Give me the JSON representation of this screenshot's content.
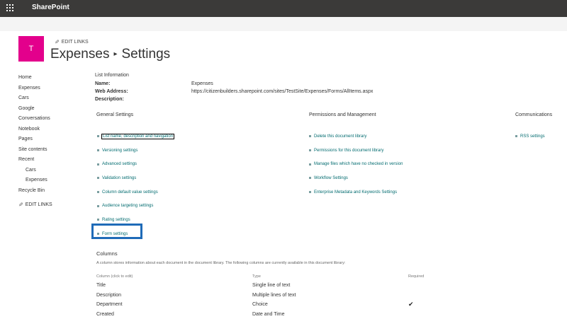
{
  "suitebar": {
    "brand": "SharePoint"
  },
  "site": {
    "logo_letter": "T",
    "edit_links": "EDIT LINKS"
  },
  "title": {
    "list": "Expenses",
    "separator": "▸",
    "page": "Settings"
  },
  "leftnav": {
    "items": [
      "Home",
      "Expenses",
      "Cars",
      "Google",
      "Conversations",
      "Notebook",
      "Pages",
      "Site contents",
      "Recent"
    ],
    "recent_items": [
      "Cars",
      "Expenses"
    ],
    "recycle": "Recycle Bin",
    "edit_links": "EDIT LINKS"
  },
  "list_info": {
    "heading": "List Information",
    "name_label": "Name:",
    "name_value": "Expenses",
    "address_label": "Web Address:",
    "address_value": "https://citizenbuilders.sharepoint.com/sites/TestSite/Expenses/Forms/AllItems.aspx",
    "description_label": "Description:"
  },
  "general": {
    "heading": "General Settings",
    "links": [
      "List name, description and navigation",
      "Versioning settings",
      "Advanced settings",
      "Validation settings",
      "Column default value settings",
      "Audience targeting settings",
      "Rating settings",
      "Form settings"
    ]
  },
  "permissions": {
    "heading": "Permissions and Management",
    "links": [
      "Delete this document library",
      "Permissions for this document library",
      "Manage files which have no checked in version",
      "Workflow Settings",
      "Enterprise Metadata and Keywords Settings"
    ]
  },
  "communications": {
    "heading": "Communications",
    "links": [
      "RSS settings"
    ]
  },
  "columns": {
    "heading": "Columns",
    "description": "A column stores information about each document in the document library. The following columns are currently available in this document library:",
    "headers": [
      "Column (click to edit)",
      "Type",
      "Required"
    ],
    "rows": [
      {
        "name": "Title",
        "type": "Single line of text",
        "required": ""
      },
      {
        "name": "Description",
        "type": "Multiple lines of text",
        "required": ""
      },
      {
        "name": "Department",
        "type": "Choice",
        "required": "✔"
      },
      {
        "name": "Created",
        "type": "Date and Time",
        "required": ""
      }
    ]
  },
  "colors": {
    "suitebar": "#3b3a39",
    "logo": "#e3008c",
    "link": "#036c70",
    "highlight": "#1f6bb8"
  }
}
